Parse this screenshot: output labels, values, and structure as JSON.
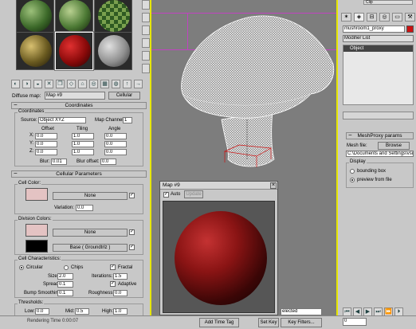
{
  "viewport": {
    "bg": "#7d7d7d",
    "object": "mushroom wireframe"
  },
  "material_editor": {
    "diffuse_label": "Diffuse map:",
    "map_name": "Map #9",
    "map_type": "Cellular",
    "toolbar_icons": [
      "get-material-icon",
      "put-material-icon",
      "assign-material-icon",
      "reset-map-icon",
      "copy-material-icon",
      "unique-icon",
      "put-library-icon",
      "material-id-icon",
      "show-map-icon",
      "show-end-result-icon",
      "go-to-parent-icon",
      "go-forward-icon"
    ],
    "coordinates": {
      "title": "Coordinates",
      "group_title": "Coordinates",
      "source_label": "Source:",
      "source_value": "Object XYZ",
      "map_channel_label": "Map Channel:",
      "map_channel_value": "1",
      "offset_label": "Offset",
      "tiling_label": "Tiling",
      "angle_label": "Angle",
      "axes": [
        {
          "axis": "X:",
          "offset": "0.0",
          "tiling": "1.0",
          "angle": "0.0"
        },
        {
          "axis": "Y:",
          "offset": "0.0",
          "tiling": "1.0",
          "angle": "0.0"
        },
        {
          "axis": "Z:",
          "offset": "0.0",
          "tiling": "1.0",
          "angle": "0.0"
        }
      ],
      "blur_label": "Blur:",
      "blur_value": "0.01",
      "blur_offset_label": "Blur offset:",
      "blur_offset_value": "0.0"
    },
    "cellular": {
      "title": "Cellular Parameters",
      "cell_color_label": "Cell Color:",
      "cell_color": "#e4c3c3",
      "none_label": "None",
      "variation_label": "Variation:",
      "variation_value": "0.0",
      "division_label": "Division Colors:",
      "div_color1": "#e4c3c3",
      "div_color2": "#000000",
      "none_label2": "None",
      "base_label": "Base  ( Groundtrlz )",
      "char_label": "Cell Characteristics:",
      "circular_label": "Circular",
      "chips_label": "Chips",
      "fractal_label": "Fractal",
      "size_label": "Size:",
      "size_value": "2.0",
      "iterations_label": "Iterations:",
      "iterations_value": "1.5",
      "spread_label": "Spread:",
      "spread_value": "0.1",
      "adaptive_label": "Adaptive",
      "bump_label": "Bump Smoothing:",
      "bump_value": "0.1",
      "roughness_label": "Roughness:",
      "roughness_value": "0.0",
      "thresholds_label": "Thresholds:",
      "low_label": "Low:",
      "low_value": "0.0",
      "mid_label": "Mid:",
      "mid_value": "0.5",
      "high_label": "High:",
      "high_value": "1.0",
      "check_mark": "✓"
    }
  },
  "map_window": {
    "title": "Map #9",
    "auto_label": "Auto",
    "update_label": "Update",
    "close_label": "×"
  },
  "command_panel": {
    "clip_label": "Clip",
    "object_name": "mushroom1_proxy",
    "modifier_list": "Modifier List",
    "stack_item": "Object",
    "meshproxy_title": "MeshProxy params",
    "mesh_file_label": "Mesh file:",
    "browse_label": "Browse",
    "mesh_path": "C:\\Documents and Settings\\vsu",
    "display_label": "Display",
    "bbox_label": "bounding box",
    "preview_label": "preview from file"
  },
  "bottom_bar": {
    "render_time": "Rendering Time 0:00:07",
    "add_time_tag": "Add Time Tag",
    "set_key": "Set Key",
    "selected": "elected",
    "key_filters": "Key Filters...",
    "frame": "0"
  }
}
